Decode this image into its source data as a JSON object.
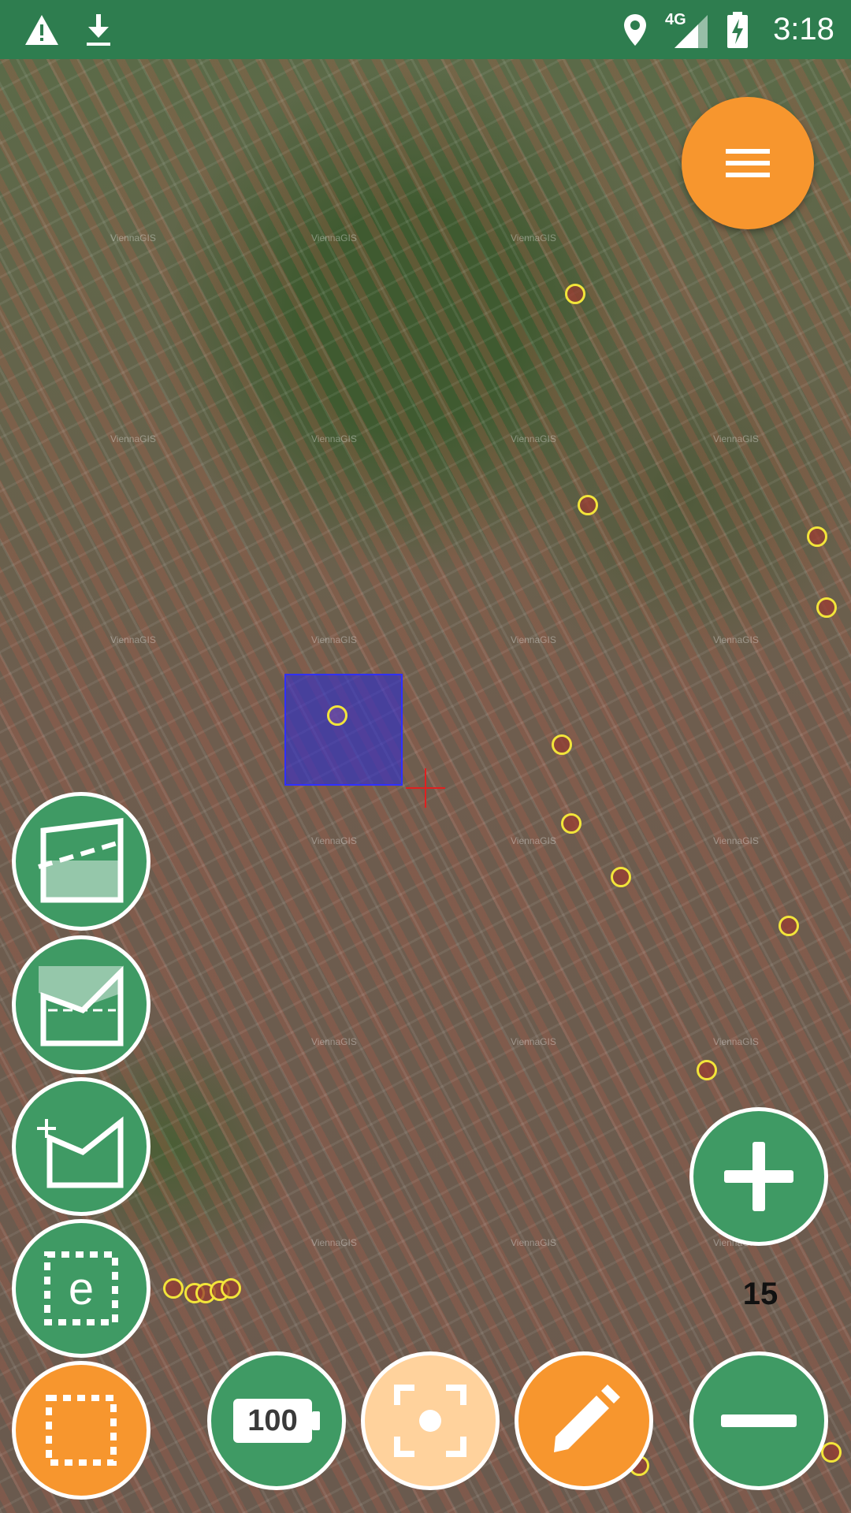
{
  "status_bar": {
    "time": "3:18",
    "network": "4G",
    "icons": [
      "warning-icon",
      "download-icon",
      "location-icon",
      "signal-icon",
      "battery-charging-icon"
    ]
  },
  "map": {
    "watermark_text": "ViennaGIS",
    "zoom_level": "15"
  },
  "buttons": {
    "battery_label": "100",
    "edit_glyph": "e"
  },
  "colors": {
    "status_bar": "#2e7d4f",
    "button_green": "#3f9a64",
    "button_orange": "#f7962e",
    "button_peach": "#ffd29c",
    "poi_ring": "#f2e53a",
    "selection_fill": "#3030ff",
    "crosshair": "#e02020"
  }
}
